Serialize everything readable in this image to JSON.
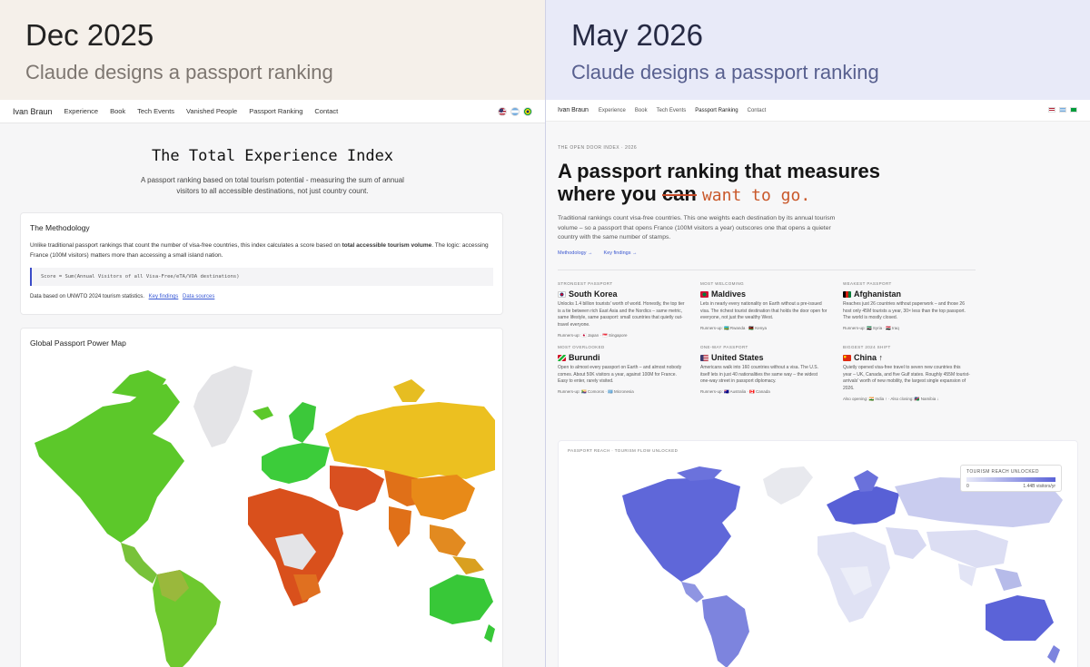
{
  "left": {
    "date": "Dec 2025",
    "subtitle": "Claude designs a passport ranking",
    "nav": {
      "brand": "Ivan Braun",
      "items": [
        "Experience",
        "Book",
        "Tech Events",
        "Vanished People",
        "Passport Ranking",
        "Contact"
      ]
    },
    "hero": {
      "title": "The Total Experience Index",
      "description": "A passport ranking based on total tourism potential - measuring the sum of annual visitors to all accessible destinations, not just country count."
    },
    "methodology": {
      "heading": "The Methodology",
      "text_before": "Unlike traditional passport rankings that count the number of visa-free countries, this index calculates a score based on ",
      "text_bold": "total accessible tourism volume",
      "text_after": ". The logic: accessing France (100M visitors) matters more than accessing a small island nation.",
      "formula": "Score = Sum(Annual Visitors of all Visa-Free/eTA/VOA destinations)",
      "footer_text": "Data based on UNWTO 2024 tourism statistics.",
      "link_findings": "Key findings",
      "link_sources": "Data sources"
    },
    "map": {
      "heading": "Global Passport Power Map"
    }
  },
  "right": {
    "date": "May 2026",
    "subtitle": "Claude designs a passport ranking",
    "nav": {
      "brand": "Ivan Braun",
      "items": [
        "Experience",
        "Book",
        "Tech Events",
        "Passport Ranking",
        "Contact"
      ],
      "active": "Passport Ranking"
    },
    "hero": {
      "kicker": "THE OPEN DOOR INDEX · 2026",
      "h1_line1": "A passport ranking that measures",
      "h1_line2_start": "where you ",
      "h1_struck": "can",
      "h1_hand": "want to go.",
      "lede": "Traditional rankings count visa-free countries. This one weights each destination by its annual tourism volume – so a passport that opens France (100M visitors a year) outscores one that opens a quieter country with the same number of stamps.",
      "link_methodology": "Methodology →",
      "link_findings": "Key findings →"
    },
    "stats": [
      {
        "kicker": "STRONGEST PASSPORT",
        "title": "South Korea",
        "flag_color": "#ffffff",
        "body": "Unlocks 1.4 billion tourists' worth of world. Honestly, the top tier is a tie between rich East Asia and the Nordics – same metric, same lifestyle, same passport: small countries that quietly out-travel everyone.",
        "runners": "Runners-up: 🇯🇵 Japan · 🇸🇬 Singapore"
      },
      {
        "kicker": "MOST WELCOMING",
        "title": "Maldives",
        "flag_color": "#c8102e",
        "body": "Lets in nearly every nationality on Earth without a pre-issued visa. The richest tourist destination that holds the door open for everyone, not just the wealthy West.",
        "runners": "Runners-up: 🇷🇼 Rwanda · 🇰🇪 Kenya"
      },
      {
        "kicker": "WEAKEST PASSPORT",
        "title": "Afghanistan",
        "flag_color": "#1a1a1a",
        "body": "Reaches just 26 countries without paperwork – and those 26 host only 45M tourists a year, 30× less than the top passport. The world is mostly closed.",
        "runners": "Runners-up: 🇸🇾 Syria · 🇮🇶 Iraq"
      },
      {
        "kicker": "MOST OVERLOOKED",
        "title": "Burundi",
        "flag_color": "#1eb53a",
        "body": "Open to almost every passport on Earth – and almost nobody comes. About 50K visitors a year, against 100M for France. Easy to enter, rarely visited.",
        "runners": "Runners-up: 🇰🇲 Comoros · 🇫🇲 Micronesia"
      },
      {
        "kicker": "ONE-WAY PASSPORT",
        "title": "United States",
        "flag_color": "#3c3b6e",
        "body": "Americans walk into 160 countries without a visa. The U.S. itself lets in just 40 nationalities the same way – the widest one-way street in passport diplomacy.",
        "runners": "Runners-up: 🇦🇺 Australia · 🇨🇦 Canada"
      },
      {
        "kicker": "BIGGEST 2024 SHIFT",
        "title": "China ↑",
        "flag_color": "#de2910",
        "body": "Quietly opened visa-free travel to seven new countries this year – UK, Canada, and five Gulf states. Roughly 455M tourist-arrivals' worth of new mobility, the largest single expansion of 2026.",
        "runners": "Also opening: 🇮🇳 India ↑ · Also closing: 🇳🇦 Namibia ↓"
      }
    ],
    "map": {
      "kicker": "PASSPORT REACH · TOURISM FLOW UNLOCKED",
      "legend_title": "TOURISM REACH UNLOCKED",
      "legend_min": "0",
      "legend_max": "1.44B visitors/yr"
    }
  }
}
